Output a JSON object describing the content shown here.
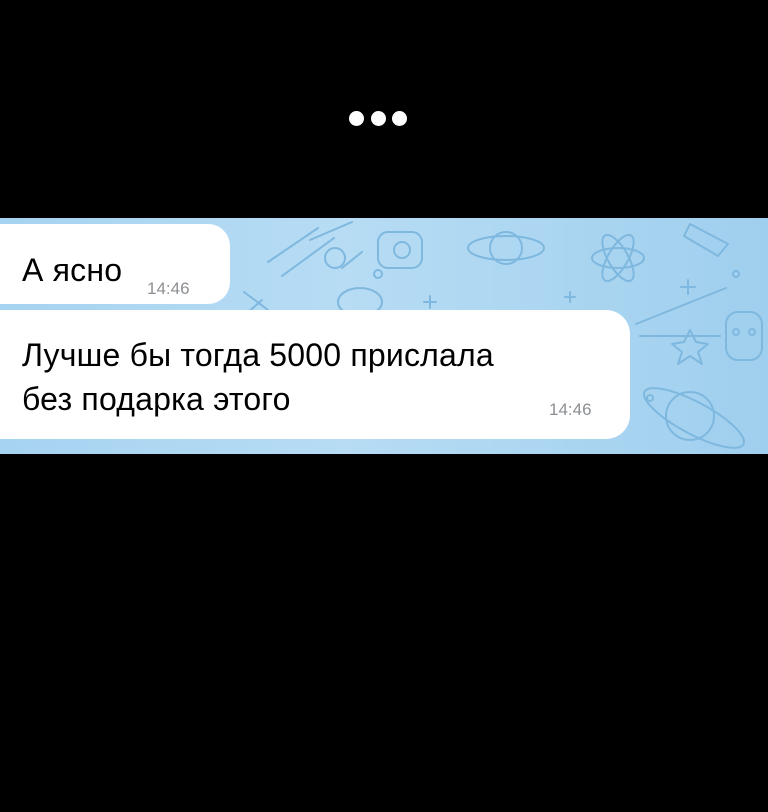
{
  "status": {
    "indicator_icon": "more-dots-icon"
  },
  "chat": {
    "background_color": "#a9d4f1",
    "bubble_color": "#ffffff",
    "messages": [
      {
        "text": "А ясно",
        "time": "14:46"
      },
      {
        "text_line1": "Лучше бы тогда 5000 прислала",
        "text_line2": "без подарка этого",
        "time": "14:46"
      }
    ]
  }
}
